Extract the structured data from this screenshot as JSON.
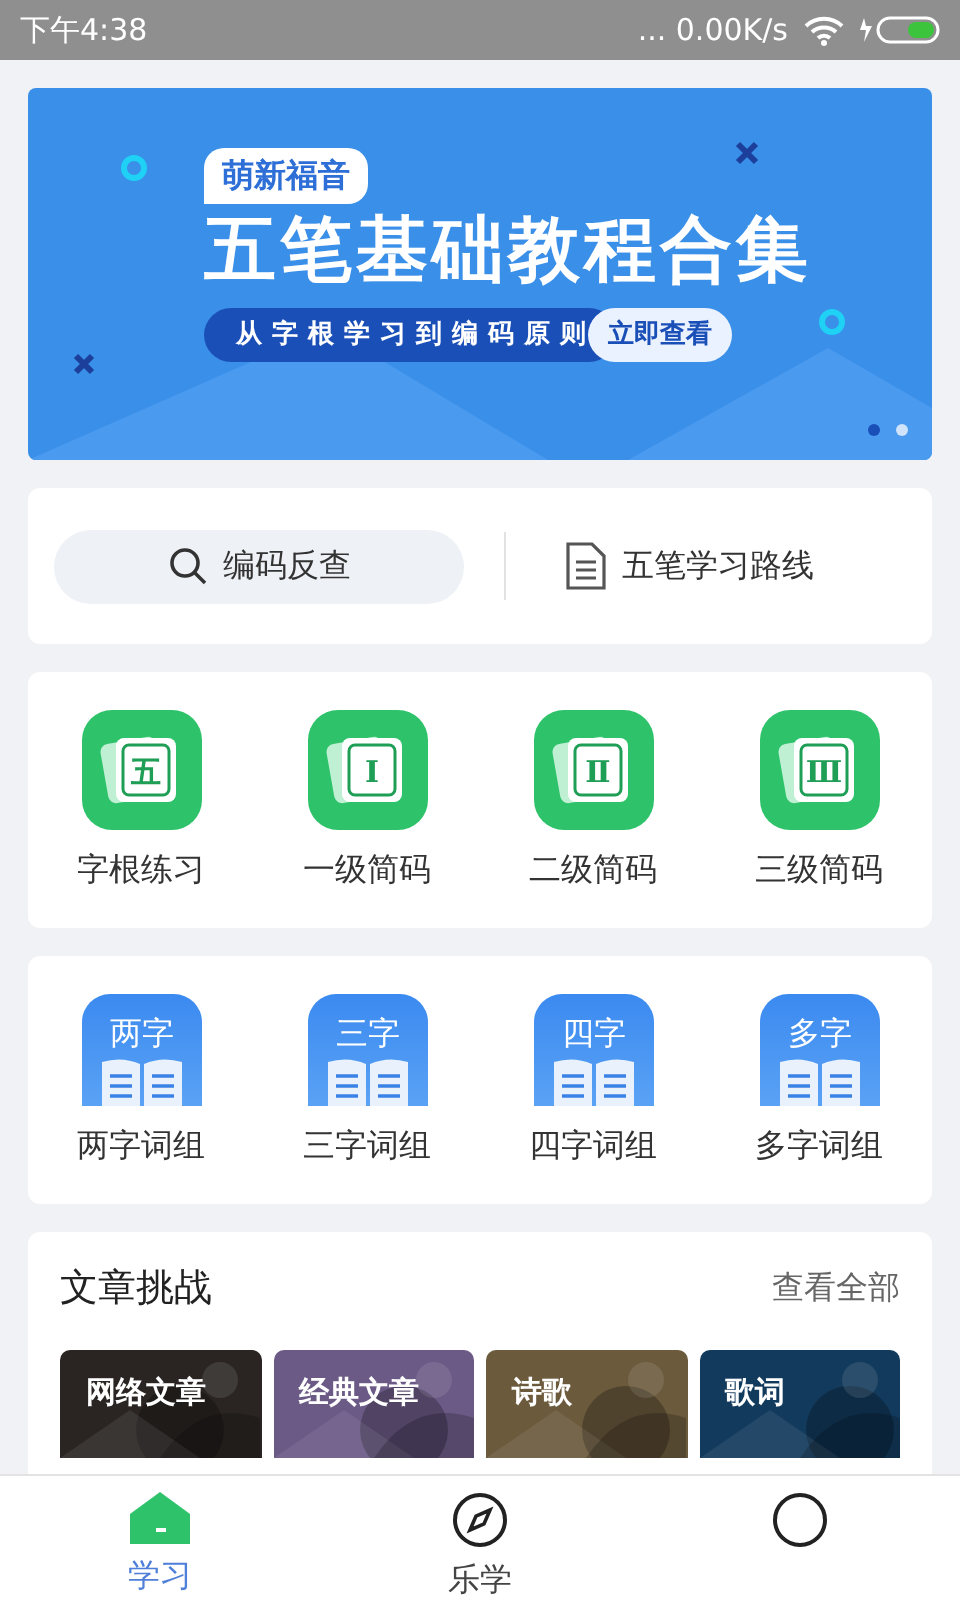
{
  "status_bar": {
    "time": "下午4:38",
    "network_speed": "... 0.00K/s"
  },
  "banner": {
    "tag": "萌新福音",
    "title": "五笔基础教程合集",
    "subtitle": "从字根学习到编码原则",
    "action": "立即查看",
    "pages": [
      {
        "selected": true
      },
      {
        "selected": false
      }
    ]
  },
  "quick_actions": {
    "search": {
      "label": "编码反查"
    },
    "route": {
      "label": "五笔学习路线"
    }
  },
  "practice": [
    {
      "label": "字根练习",
      "glyph": "五"
    },
    {
      "label": "一级简码",
      "glyph": "Ⅰ"
    },
    {
      "label": "二级简码",
      "glyph": "Ⅱ"
    },
    {
      "label": "三级简码",
      "glyph": "Ⅲ"
    }
  ],
  "phrases": [
    {
      "label": "两字词组",
      "glyph": "两字"
    },
    {
      "label": "三字词组",
      "glyph": "三字"
    },
    {
      "label": "四字词组",
      "glyph": "四字"
    },
    {
      "label": "多字词组",
      "glyph": "多字"
    }
  ],
  "articles": {
    "title": "文章挑战",
    "more": "查看全部",
    "items": [
      {
        "label": "网络文章",
        "color": "#2a2522"
      },
      {
        "label": "经典文章",
        "color": "#6b5a86"
      },
      {
        "label": "诗歌",
        "color": "#6b5a3c"
      },
      {
        "label": "歌词",
        "color": "#123a5c"
      }
    ]
  },
  "tab_bar": [
    {
      "kind": "home",
      "label": "学习",
      "selected": true
    },
    {
      "kind": "compass",
      "label": "乐学",
      "selected": false
    },
    {
      "kind": "circle",
      "selected": false
    }
  ]
}
